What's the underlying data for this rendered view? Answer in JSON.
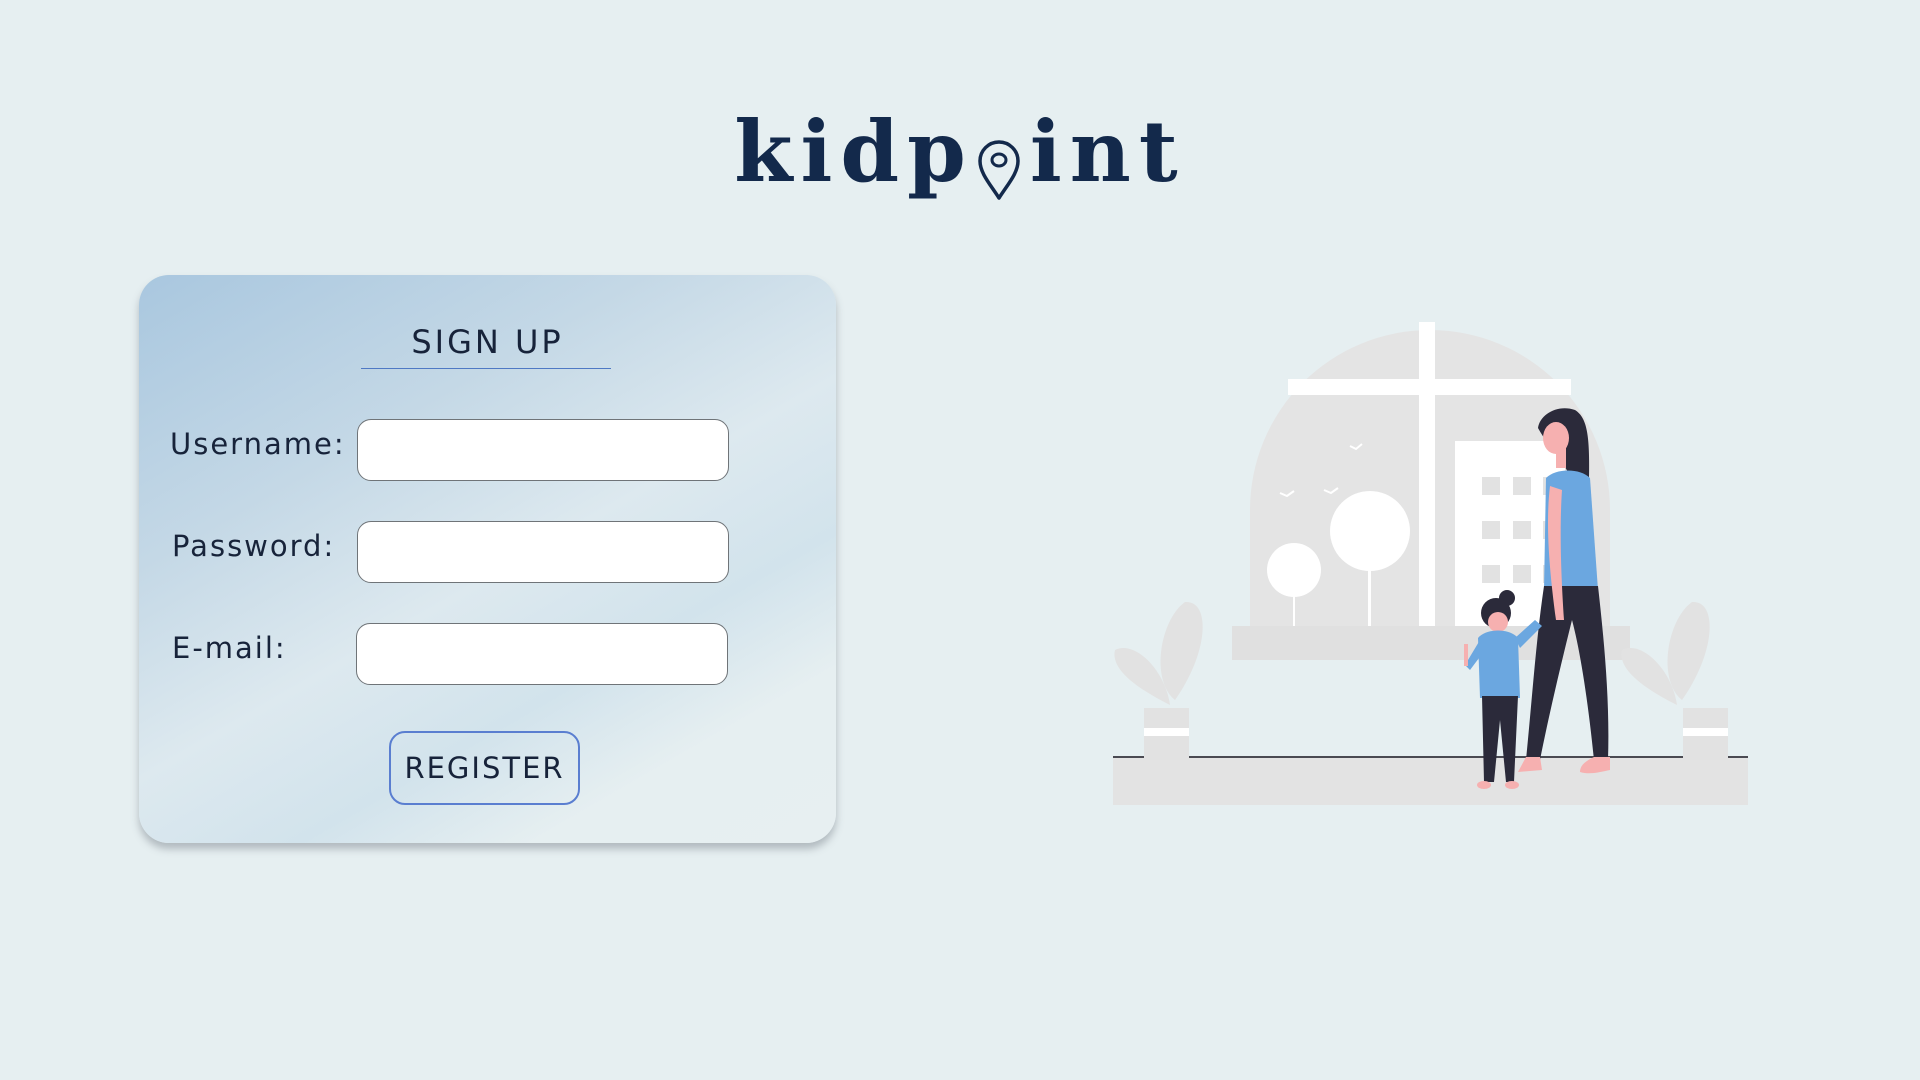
{
  "app": {
    "logo_text_left": "kidp",
    "logo_text_right": "int",
    "logo_icon": "location-pin-icon",
    "brand_color": "#13294b"
  },
  "signup": {
    "title": "SIGN UP",
    "fields": [
      {
        "label": "Username:",
        "value": "",
        "placeholder": ""
      },
      {
        "label": "Password:",
        "value": "",
        "placeholder": ""
      },
      {
        "label": "E-mail:",
        "value": "",
        "placeholder": ""
      }
    ],
    "register_label": "REGISTER",
    "accent_color": "#5a7ed0"
  },
  "illustration": {
    "subject": "mother-and-child-at-window-illustration"
  }
}
